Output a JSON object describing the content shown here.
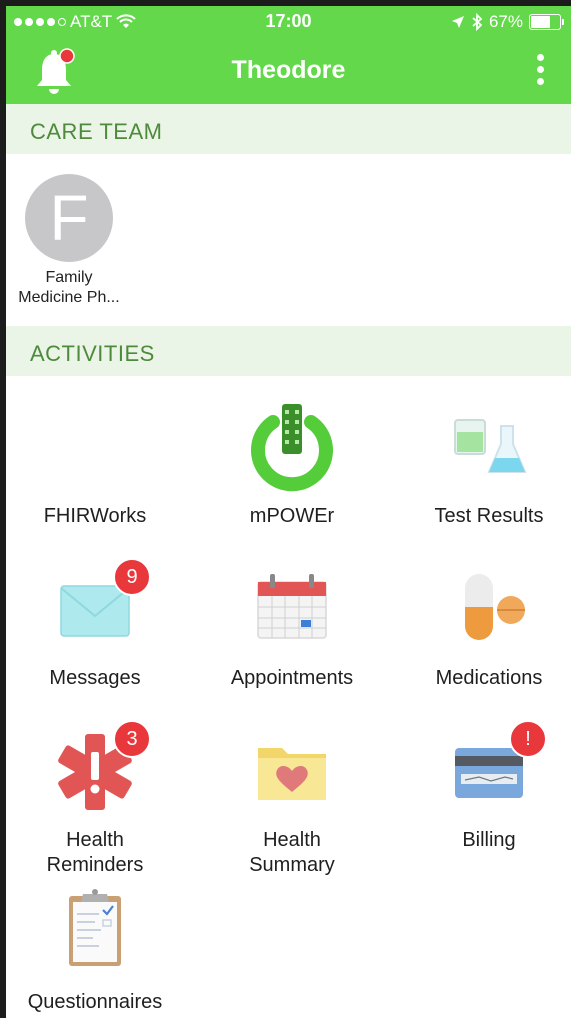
{
  "status_bar": {
    "carrier": "AT&T",
    "time": "17:00",
    "battery": "67%"
  },
  "header": {
    "title": "Theodore"
  },
  "care_team": {
    "heading": "CARE TEAM",
    "members": [
      {
        "initial": "F",
        "name_line1": "Family",
        "name_line2": "Medicine Ph..."
      }
    ]
  },
  "activities": {
    "heading": "ACTIVITIES",
    "items": [
      {
        "label": "FHIRWorks",
        "icon": "blank"
      },
      {
        "label": "mPOWEr",
        "icon": "power-icon"
      },
      {
        "label": "Test Results",
        "icon": "lab-flasks-icon"
      },
      {
        "label": "Messages",
        "icon": "envelope-icon",
        "badge": "9"
      },
      {
        "label": "Appointments",
        "icon": "calendar-icon"
      },
      {
        "label": "Medications",
        "icon": "pill-icon"
      },
      {
        "label_line1": "Health",
        "label_line2": "Reminders",
        "icon": "medical-alert-icon",
        "badge": "3"
      },
      {
        "label_line1": "Health",
        "label_line2": "Summary",
        "icon": "folder-heart-icon"
      },
      {
        "label": "Billing",
        "icon": "credit-card-icon",
        "badge": "!"
      },
      {
        "label": "Questionnaires",
        "icon": "clipboard-icon"
      }
    ]
  },
  "colors": {
    "header_green": "#62d84a",
    "section_text": "#4e8a3c",
    "section_bg": "#eaf5e7",
    "badge_red": "#e8383b"
  }
}
